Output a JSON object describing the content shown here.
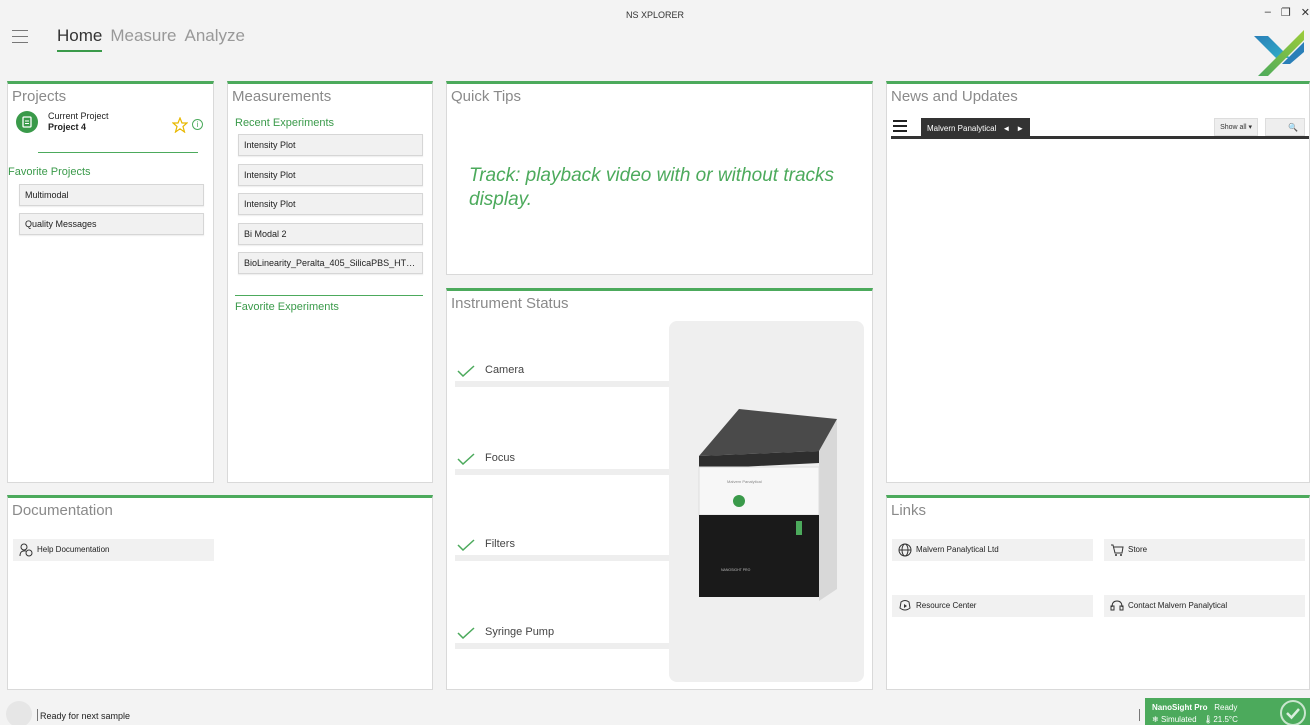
{
  "app": {
    "title": "NS XPLORER"
  },
  "window_controls": {
    "minimize": "–",
    "maximize": "❐",
    "close": "✕"
  },
  "nav": {
    "tabs": [
      {
        "label": "Home",
        "active": true
      },
      {
        "label": "Measure",
        "active": false
      },
      {
        "label": "Analyze",
        "active": false
      }
    ]
  },
  "projects": {
    "title": "Projects",
    "current_label": "Current Project",
    "current_name": "Project 4",
    "favorites_label": "Favorite Projects",
    "favorites": [
      "Multimodal",
      "Quality Messages"
    ]
  },
  "measurements": {
    "title": "Measurements",
    "recent_label": "Recent Experiments",
    "recent": [
      "Intensity Plot",
      "Intensity Plot",
      "Intensity Plot",
      "Bi Modal 2",
      "BioLinearity_Peralta_405_SilicaPBS_HT_4..."
    ],
    "favorites_label": "Favorite Experiments"
  },
  "quick_tips": {
    "title": "Quick Tips",
    "tip": "Track: playback video with or without tracks display."
  },
  "instrument_status": {
    "title": "Instrument Status",
    "items": [
      "Camera",
      "Focus",
      "Filters",
      "Syringe Pump"
    ],
    "device_brand": "Malvern Panalytical",
    "device_model": "NANOSIGHT PRO"
  },
  "news": {
    "title": "News and Updates",
    "tab_label": "Malvern Panalytical",
    "prev": "◄",
    "next": "►",
    "filter": "Show all ▾",
    "search": "🔍"
  },
  "documentation": {
    "title": "Documentation",
    "links": [
      "Help Documentation"
    ]
  },
  "links": {
    "title": "Links",
    "items": [
      "Malvern Panalytical Ltd",
      "Store",
      "Resource Center",
      "Contact Malvern Panalytical"
    ]
  },
  "statusbar": {
    "message": "Ready for next sample",
    "instrument": "NanoSight Pro",
    "state": "Ready",
    "mode": "Simulated",
    "temperature": "21.5°C"
  },
  "colors": {
    "accent": "#4caa5c",
    "accent_dark": "#3a9a4a",
    "news_bar": "#333333"
  }
}
